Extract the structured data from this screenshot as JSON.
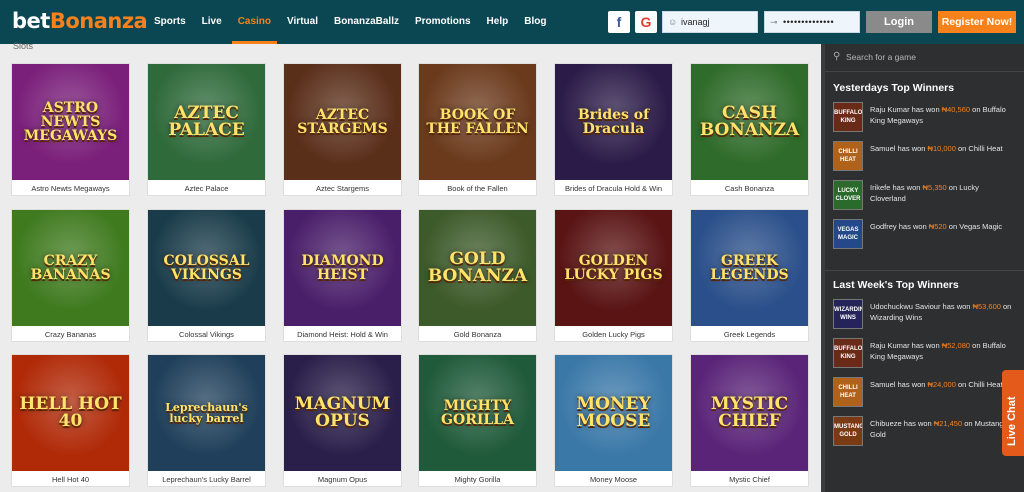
{
  "brand": {
    "part1": "bet",
    "part2": "Bonanza"
  },
  "nav": [
    "Sports",
    "Live",
    "Casino",
    "Virtual",
    "BonanzaBallz",
    "Promotions",
    "Help",
    "Blog"
  ],
  "nav_active": "Casino",
  "auth": {
    "facebook_glyph": "f",
    "google_glyph": "G",
    "username_value": "ivanagj",
    "password_value": "••••••••••••••",
    "login_label": "Login",
    "register_label": "Register Now!"
  },
  "section_tag": "Slots",
  "games": [
    {
      "name": "Astro Newts Megaways",
      "art": "ASTRO NEWTS MEGAWAYS",
      "bg": "#7a1f7a"
    },
    {
      "name": "Aztec Palace",
      "art": "AZTEC PALACE",
      "bg": "#2f6a3a"
    },
    {
      "name": "Aztec Stargems",
      "art": "AZTEC STARGEMS",
      "bg": "#5a2f1a"
    },
    {
      "name": "Book of the Fallen",
      "art": "BOOK OF THE FALLEN",
      "bg": "#6b3a1c"
    },
    {
      "name": "Brides of Dracula Hold & Win",
      "art": "Brides of Dracula",
      "bg": "#2b1b48"
    },
    {
      "name": "Cash Bonanza",
      "art": "CASH BONANZA",
      "bg": "#2f6b2a"
    },
    {
      "name": "Crazy Bananas",
      "art": "CRAZY BANANAS",
      "bg": "#3f7a1e"
    },
    {
      "name": "Colossal Vikings",
      "art": "COLOSSAL VIKINGS",
      "bg": "#1a3c4a"
    },
    {
      "name": "Diamond Heist: Hold & Win",
      "art": "DIAMOND HEIST",
      "bg": "#4a1f6a"
    },
    {
      "name": "Gold Bonanza",
      "art": "GOLD BONANZA",
      "bg": "#3d5a2a"
    },
    {
      "name": "Golden Lucky Pigs",
      "art": "GOLDEN LUCKY PIGS",
      "bg": "#5a1414"
    },
    {
      "name": "Greek Legends",
      "art": "GREEK LEGENDS",
      "bg": "#2a4f8a"
    },
    {
      "name": "Hell Hot 40",
      "art": "HELL HOT 40",
      "bg": "#b02a08"
    },
    {
      "name": "Leprechaun's Lucky Barrel",
      "art": "Leprechaun's lucky barrel",
      "bg": "#1f3f5a"
    },
    {
      "name": "Magnum Opus",
      "art": "MAGNUM OPUS",
      "bg": "#2a1f4a"
    },
    {
      "name": "Mighty Gorilla",
      "art": "MIGHTY GORILLA",
      "bg": "#1f5a3a"
    },
    {
      "name": "Money Moose",
      "art": "MONEY MOOSE",
      "bg": "#3a78a8"
    },
    {
      "name": "Mystic Chief",
      "art": "MYSTIC CHIEF",
      "bg": "#5a2478"
    }
  ],
  "sidebar": {
    "search_placeholder": "Search for a game",
    "yesterday_title": "Yesterdays Top Winners",
    "yesterday": [
      {
        "pre": "Raju Kumar has won ",
        "amount": "₦40,560",
        "post": " on Buffalo King Megaways",
        "av": "BUFFALO KING",
        "av_bg": "#6a2a18"
      },
      {
        "pre": "Samuel has won ",
        "amount": "₦10,000",
        "post": " on Chilli Heat",
        "av": "CHILLI HEAT",
        "av_bg": "#b0621a"
      },
      {
        "pre": "Irikefe has won ",
        "amount": "₦5,350",
        "post": " on Lucky Cloverland",
        "av": "LUCKY CLOVER",
        "av_bg": "#2a6a2a"
      },
      {
        "pre": "Godfrey has won ",
        "amount": "₦520",
        "post": " on Vegas Magic",
        "av": "VEGAS MAGIC",
        "av_bg": "#24488a"
      }
    ],
    "lastweek_title": "Last Week's Top Winners",
    "lastweek": [
      {
        "pre": "Udochuckwu Saviour has won ",
        "amount": "₦53,600",
        "post": " on Wizarding Wins",
        "av": "WIZARDING WINS",
        "av_bg": "#24245a"
      },
      {
        "pre": "Raju Kumar has won ",
        "amount": "₦52,080",
        "post": " on Buffalo King Megaways",
        "av": "BUFFALO KING",
        "av_bg": "#6a2a18"
      },
      {
        "pre": "Samuel has won ",
        "amount": "₦24,000",
        "post": " on Chilli Heat",
        "av": "CHILLI HEAT",
        "av_bg": "#b0621a"
      },
      {
        "pre": "Chibueze has won ",
        "amount": "₦21,450",
        "post": " on Mustang Gold",
        "av": "MUSTANG GOLD",
        "av_bg": "#7a3a14"
      }
    ]
  },
  "live_chat_label": "Live Chat",
  "colors": {
    "header": "#0b4653",
    "accent": "#f7821b",
    "sidebar": "#2e2f31"
  },
  "icons": [
    "facebook-icon",
    "google-icon",
    "user-icon",
    "key-icon",
    "search-icon"
  ]
}
